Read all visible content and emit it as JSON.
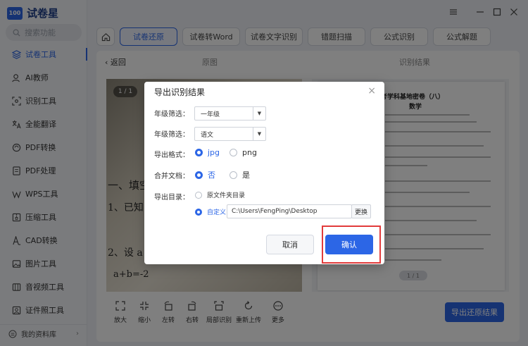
{
  "app": {
    "logo_mark": "100",
    "name": "试卷星"
  },
  "sidebar": {
    "search_placeholder": "搜索功能",
    "items": [
      {
        "label": "试卷工具",
        "icon": "layers-icon",
        "active": true
      },
      {
        "label": "AI教师",
        "icon": "ai-teacher-icon"
      },
      {
        "label": "识别工具",
        "icon": "scan-icon"
      },
      {
        "label": "全能翻译",
        "icon": "translate-icon"
      },
      {
        "label": "PDF转换",
        "icon": "pdf-convert-icon"
      },
      {
        "label": "PDF处理",
        "icon": "pdf-process-icon"
      },
      {
        "label": "WPS工具",
        "icon": "wps-icon"
      },
      {
        "label": "压缩工具",
        "icon": "compress-icon"
      },
      {
        "label": "CAD转换",
        "icon": "cad-icon"
      },
      {
        "label": "图片工具",
        "icon": "image-icon"
      },
      {
        "label": "音视频工具",
        "icon": "media-icon"
      },
      {
        "label": "证件照工具",
        "icon": "id-photo-icon"
      }
    ],
    "bottom_label": "我的资料库"
  },
  "tabs": [
    "试卷还原",
    "试卷转Word",
    "试卷文字识别",
    "错题扫描",
    "公式识别",
    "公式解题"
  ],
  "content": {
    "back_label": "返回",
    "original_label": "原图",
    "result_label": "识别结果",
    "left_page_count": "1 / 1",
    "right_page_count": "1 / 1",
    "doc_title": "考学科基地密卷（八）",
    "doc_subject": "数学",
    "photo_lines": [
      "一、填空",
      "1、已知",
      "2、设 a",
      "a+b=-2"
    ],
    "tools": [
      "放大",
      "缩小",
      "左转",
      "右转",
      "局部识别",
      "重新上传",
      "更多"
    ],
    "export_label": "导出还原结果"
  },
  "dialog": {
    "title": "导出识别结果",
    "grade_label": "年级筛选：",
    "grade_value": "一年级",
    "subject_label": "年级筛选：",
    "subject_value": "语文",
    "format_label": "导出格式：",
    "format_options": [
      "jpg",
      "png"
    ],
    "merge_label": "合并文档：",
    "merge_options": [
      "否",
      "是"
    ],
    "dir_label": "导出目录：",
    "dir_option_source": "原文件夹目录",
    "dir_option_custom": "自定义",
    "dir_path": "C:\\Users\\FengPing\\Desktop",
    "change_label": "更换",
    "cancel_label": "取消",
    "confirm_label": "确认"
  }
}
